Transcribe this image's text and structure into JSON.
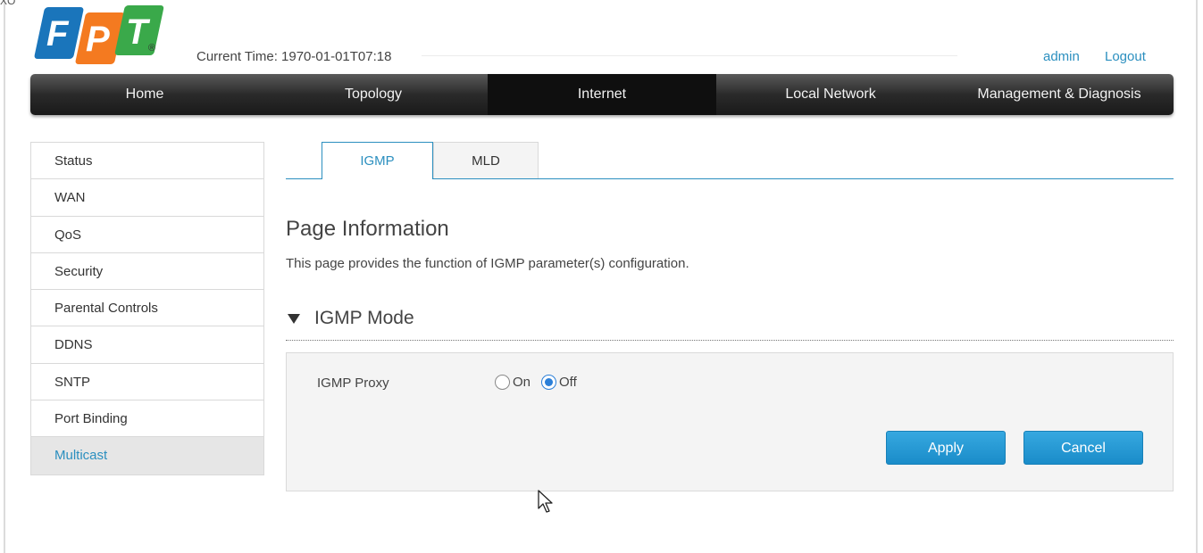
{
  "corner_text": "XO",
  "logo": {
    "letters": [
      "F",
      "P",
      "T"
    ],
    "registered": "®"
  },
  "header": {
    "current_time_label": "Current Time: 1970-01-01T07:18",
    "user": "admin",
    "logout": "Logout"
  },
  "nav": {
    "items": [
      "Home",
      "Topology",
      "Internet",
      "Local Network",
      "Management & Diagnosis"
    ],
    "active": "Internet"
  },
  "sidebar": {
    "items": [
      "Status",
      "WAN",
      "QoS",
      "Security",
      "Parental Controls",
      "DDNS",
      "SNTP",
      "Port Binding",
      "Multicast"
    ],
    "active": "Multicast"
  },
  "tabs": {
    "items": [
      "IGMP",
      "MLD"
    ],
    "active": "IGMP"
  },
  "page": {
    "title": "Page Information",
    "description": "This page provides the function of IGMP parameter(s) configuration."
  },
  "section": {
    "title": "IGMP Mode",
    "proxy_label": "IGMP Proxy",
    "options": [
      "On",
      "Off"
    ],
    "selected": "Off"
  },
  "buttons": {
    "apply": "Apply",
    "cancel": "Cancel"
  },
  "colors": {
    "accent": "#2b8fbf",
    "button": "#1a8cc9",
    "nav_dark": "#2a2a2a"
  }
}
